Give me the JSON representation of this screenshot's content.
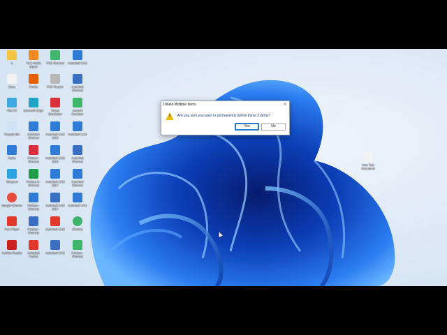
{
  "dialog": {
    "title": "Delete Multiple Items",
    "close_label": "×",
    "message": "Are you sure you want to permanently delete these 2 items?",
    "yes_label": "Yes",
    "no_label": "No"
  },
  "colors": {
    "wallpaper_bloom": "#1e5fe0",
    "wallpaper_background": "#dfe9f5",
    "warning": "#f3c010",
    "dialog_default_button": "#2b78d0"
  },
  "desktop_icons": [
    {
      "label": "s",
      "icon": "folder-icon",
      "color": "#f5c542"
    },
    {
      "label": "Docs",
      "icon": "document-icon",
      "color": "#f2f2f2"
    },
    {
      "label": "This PC",
      "icon": "computer-icon",
      "color": "#3fa9e0"
    },
    {
      "label": "Recycle Bin",
      "icon": "recycle-bin-icon",
      "color": "#cfe3f7"
    },
    {
      "label": "Tasks",
      "icon": "tasks-icon",
      "color": "#2f7bd6"
    },
    {
      "label": "Telegram",
      "icon": "telegram-icon",
      "color": "#2aa3e0"
    },
    {
      "label": "Google Chrome",
      "icon": "chrome-icon",
      "color": "#e84c3d"
    },
    {
      "label": "VLC Player",
      "icon": "media-player-icon",
      "color": "#e0392b"
    },
    {
      "label": "Acrobat Reader",
      "icon": "pdf-icon",
      "color": "#c9211e"
    },
    {
      "label": "VLC media player",
      "icon": "vlc-icon",
      "color": "#f08a24"
    },
    {
      "label": "Firefox",
      "icon": "firefox-icon",
      "color": "#e66000"
    },
    {
      "label": "Microsoft Edge",
      "icon": "edge-icon",
      "color": "#22a4c9"
    },
    {
      "label": "Autodesk Shortcut",
      "icon": "app-icon",
      "color": "#2f7bd6"
    },
    {
      "label": "Proteus - Shortcut",
      "icon": "app-icon",
      "color": "#d9313b"
    },
    {
      "label": "Proteus 8 - Shortcut",
      "icon": "app-icon",
      "color": "#1f9e4a"
    },
    {
      "label": "Proteus - Shortcut",
      "icon": "app-icon",
      "color": "#2f7bd6"
    },
    {
      "label": "Proteus - Shortcut",
      "icon": "app-icon",
      "color": "#3a6fc4"
    },
    {
      "label": "Autodesk Fusion",
      "icon": "app-icon",
      "color": "#e0392b"
    },
    {
      "label": "PSD Shortcut",
      "icon": "app-icon",
      "color": "#3db56a"
    },
    {
      "label": "PDF Reader",
      "icon": "pdf-icon",
      "color": "#b7b7b7"
    },
    {
      "label": "Virtual Simulation",
      "icon": "app-icon",
      "color": "#d9313b"
    },
    {
      "label": "Autodesk CAD 2018",
      "icon": "app-icon",
      "color": "#2f7bd6"
    },
    {
      "label": "Autodesk CAD 2018",
      "icon": "app-icon",
      "color": "#2f7bd6"
    },
    {
      "label": "Autodesk CAD 2017",
      "icon": "app-icon",
      "color": "#2f7bd6"
    },
    {
      "label": "Autodesk CAD 2017",
      "icon": "app-icon",
      "color": "#3a6fc4"
    },
    {
      "label": "Autodesk CAD",
      "icon": "app-icon",
      "color": "#e0392b"
    },
    {
      "label": "Autodesk CAD",
      "icon": "app-icon",
      "color": "#3a6fc4"
    },
    {
      "label": "Autodesk CAD",
      "icon": "app-icon",
      "color": "#2f7bd6"
    },
    {
      "label": "Autodesk Shortcut",
      "icon": "app-icon",
      "color": "#3a6fc4"
    },
    {
      "label": "Android Emulator",
      "icon": "android-icon",
      "color": "#3db56a"
    },
    {
      "label": "Autodesk CAD",
      "icon": "app-icon",
      "color": "#2f7bd6"
    },
    {
      "label": "Autodesk Shortcut",
      "icon": "app-icon",
      "color": "#3a6fc4"
    },
    {
      "label": "Autodesk Shortcut",
      "icon": "app-icon",
      "color": "#2f7bd6"
    },
    {
      "label": "Autodesk CAD",
      "icon": "app-icon",
      "color": "#2f7bd6"
    },
    {
      "label": "Chrome",
      "icon": "chrome-icon",
      "color": "#3db56a"
    },
    {
      "label": "Proteus - Shortcut",
      "icon": "app-icon",
      "color": "#3db56a"
    },
    {
      "label": "New Text Document",
      "icon": "text-file-icon",
      "color": "#f2f2f2"
    }
  ]
}
